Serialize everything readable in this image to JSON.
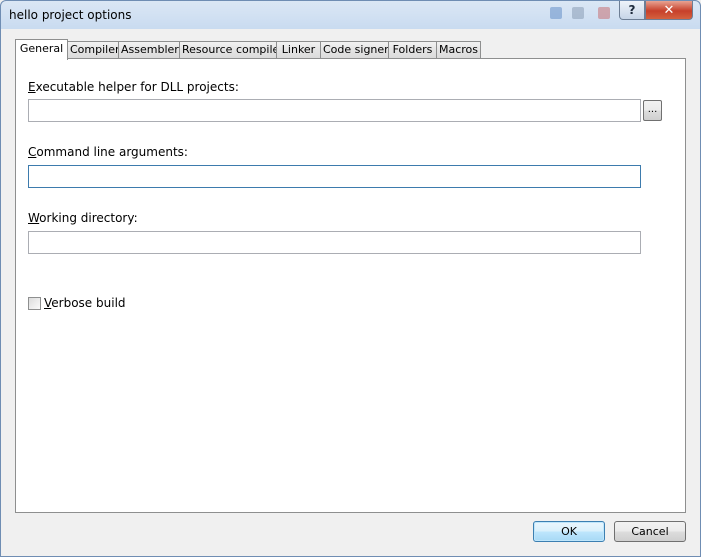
{
  "window": {
    "title": "hello project options"
  },
  "titlebar": {
    "help_label": "?",
    "close_label": "✕"
  },
  "tabs": [
    {
      "label": "General",
      "active": true
    },
    {
      "label": "Compiler",
      "active": false
    },
    {
      "label": "Assembler",
      "active": false
    },
    {
      "label": "Resource compiler",
      "active": false
    },
    {
      "label": "Linker",
      "active": false
    },
    {
      "label": "Code signer",
      "active": false
    },
    {
      "label": "Folders",
      "active": false
    },
    {
      "label": "Macros",
      "active": false
    }
  ],
  "general": {
    "executable_helper": {
      "label": "Executable helper for DLL projects:",
      "accel": "E",
      "value": "",
      "browse_label": "..."
    },
    "command_line": {
      "label": "Command line arguments:",
      "accel": "C",
      "value": ""
    },
    "working_dir": {
      "label": "Working directory:",
      "accel": "W",
      "value": ""
    },
    "verbose_build": {
      "label": "Verbose build",
      "accel": "V",
      "checked": false
    }
  },
  "buttons": {
    "ok_label": "OK",
    "cancel_label": "Cancel"
  },
  "colors": {
    "close_button": "#c7402a",
    "default_button_border": "#3c7fb1",
    "focus_border": "#3d7bad"
  }
}
